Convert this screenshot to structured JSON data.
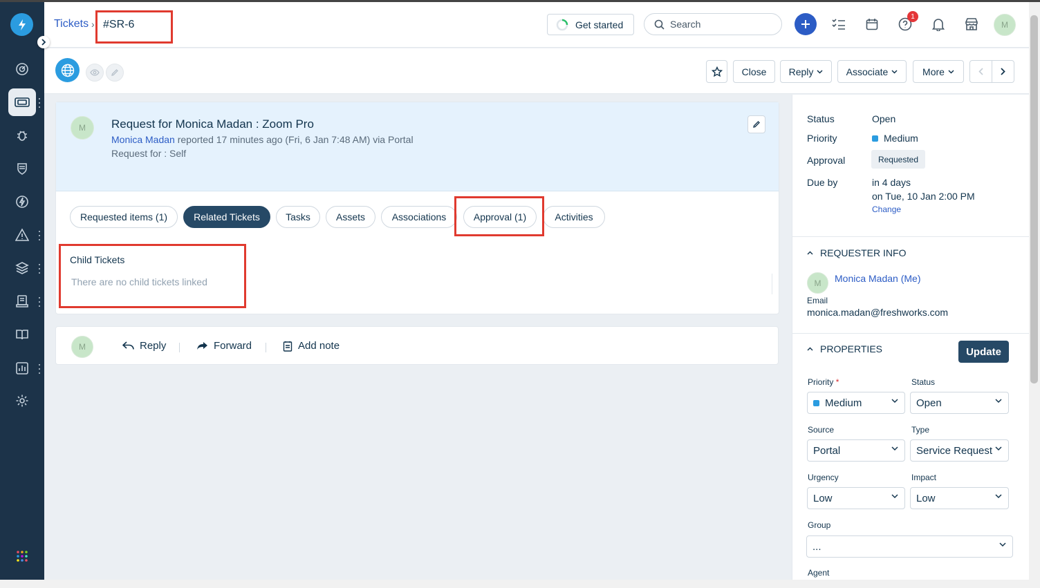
{
  "topbar": {
    "breadcrumb": "Tickets",
    "breadcrumb_sep": "›",
    "ticket_id": "#SR-6",
    "get_started": "Get started",
    "search_placeholder": "Search",
    "help_badge": "1",
    "avatar_initial": "M"
  },
  "actions": {
    "close": "Close",
    "reply": "Reply",
    "associate": "Associate",
    "more": "More"
  },
  "ticket": {
    "avatar_initial": "M",
    "title": "Request for Monica Madan : Zoom Pro",
    "requester": "Monica Madan",
    "reported": " reported 17 minutes ago (Fri, 6 Jan 7:48 AM) via Portal",
    "request_for": "Request for : Self"
  },
  "tabs": [
    {
      "label": "Requested items (1)"
    },
    {
      "label": "Related Tickets"
    },
    {
      "label": "Tasks"
    },
    {
      "label": "Assets"
    },
    {
      "label": "Associations"
    },
    {
      "label": "Approval (1)"
    },
    {
      "label": "Activities"
    }
  ],
  "child_tickets": {
    "title": "Child Tickets",
    "empty": "There are no child tickets linked"
  },
  "reply_bar": {
    "avatar_initial": "M",
    "reply": "Reply",
    "forward": "Forward",
    "add_note": "Add note"
  },
  "summary": {
    "status_label": "Status",
    "status_value": "Open",
    "priority_label": "Priority",
    "priority_value": "Medium",
    "approval_label": "Approval",
    "approval_value": "Requested",
    "due_label": "Due by",
    "due_value": "in 4 days",
    "due_date": "on Tue, 10 Jan 2:00 PM",
    "change": "Change"
  },
  "requester_info": {
    "title": "REQUESTER INFO",
    "avatar_initial": "M",
    "name": "Monica Madan (Me)",
    "email_label": "Email",
    "email": "monica.madan@freshworks.com"
  },
  "properties": {
    "title": "PROPERTIES",
    "update": "Update",
    "priority_label": "Priority",
    "required_mark": "*",
    "priority_value": "Medium",
    "status_label": "Status",
    "status_value": "Open",
    "source_label": "Source",
    "source_value": "Portal",
    "type_label": "Type",
    "type_value": "Service Request",
    "urgency_label": "Urgency",
    "urgency_value": "Low",
    "impact_label": "Impact",
    "impact_value": "Low",
    "group_label": "Group",
    "group_value": "...",
    "agent_label": "Agent"
  },
  "colors": {
    "sidebar": "#1c3349",
    "brand_blue": "#2b9ce0",
    "link": "#2c5cc5",
    "dark_button": "#264966",
    "highlight_red": "#e03a2f"
  }
}
